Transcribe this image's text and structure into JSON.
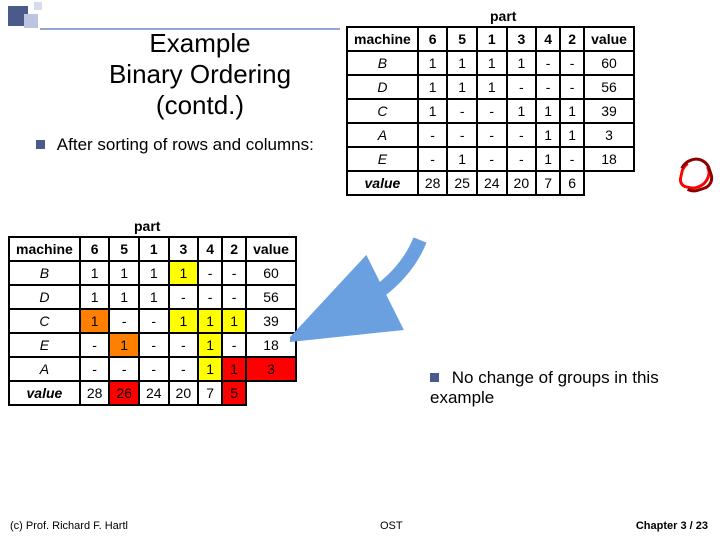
{
  "title": "Example\nBinary Ordering\n(contd.)",
  "bullet_after": "After sorting of rows and columns:",
  "bullet_nochange": "No change of groups in this example",
  "part_label": "part",
  "table_top": {
    "col_header": "machine",
    "parts": [
      "6",
      "5",
      "1",
      "3",
      "4",
      "2"
    ],
    "value_header": "value",
    "rows": [
      {
        "m": "B",
        "cells": [
          "1",
          "1",
          "1",
          "1",
          "-",
          "-"
        ],
        "val": "60"
      },
      {
        "m": "D",
        "cells": [
          "1",
          "1",
          "1",
          "-",
          "-",
          "-"
        ],
        "val": "56"
      },
      {
        "m": "C",
        "cells": [
          "1",
          "-",
          "-",
          "1",
          "1",
          "1"
        ],
        "val": "39"
      },
      {
        "m": "A",
        "cells": [
          "-",
          "-",
          "-",
          "-",
          "1",
          "1"
        ],
        "val": "3"
      },
      {
        "m": "E",
        "cells": [
          "-",
          "1",
          "-",
          "-",
          "1",
          "-"
        ],
        "val": "18"
      }
    ],
    "value_row_label": "value",
    "value_row": [
      "28",
      "25",
      "24",
      "20",
      "7",
      "6"
    ]
  },
  "table_mid": {
    "col_header": "machine",
    "parts": [
      "6",
      "5",
      "1",
      "3",
      "4",
      "2"
    ],
    "value_header": "value",
    "rows": [
      {
        "m": "B",
        "cells": [
          "1",
          "1",
          "1",
          "1",
          "-",
          "-"
        ],
        "val": "60",
        "hi": [
          0,
          0,
          0,
          "y",
          null,
          null
        ]
      },
      {
        "m": "D",
        "cells": [
          "1",
          "1",
          "1",
          "-",
          "-",
          "-"
        ],
        "val": "56",
        "hi": [
          0,
          0,
          0,
          null,
          null,
          null
        ]
      },
      {
        "m": "C",
        "cells": [
          "1",
          "-",
          "-",
          "1",
          "1",
          "1"
        ],
        "val": "39",
        "hi": [
          "o",
          null,
          null,
          "y",
          "y",
          "y"
        ]
      },
      {
        "m": "E",
        "cells": [
          "-",
          "1",
          "-",
          "-",
          "1",
          "-"
        ],
        "val": "18",
        "hi": [
          null,
          "o",
          null,
          null,
          "y",
          null
        ]
      },
      {
        "m": "A",
        "cells": [
          "-",
          "-",
          "-",
          "-",
          "1",
          "1"
        ],
        "val": "3",
        "hi": [
          null,
          null,
          null,
          null,
          "y",
          "r"
        ]
      }
    ],
    "value_row_label": "value",
    "value_row": [
      "28",
      "26",
      "24",
      "20",
      "7",
      "5"
    ],
    "value_row_hi": [
      null,
      "r",
      null,
      null,
      null,
      "r"
    ]
  },
  "footer": {
    "left": "(c) Prof. Richard F. Hartl",
    "mid": "OST",
    "right": "Chapter 3 / 23"
  },
  "chart_data": [
    {
      "type": "table",
      "title": "Machine-part incidence (before row swap)",
      "row_labels": [
        "B",
        "D",
        "C",
        "A",
        "E"
      ],
      "col_labels": [
        "6",
        "5",
        "1",
        "3",
        "4",
        "2"
      ],
      "matrix": [
        [
          1,
          1,
          1,
          1,
          0,
          0
        ],
        [
          1,
          1,
          1,
          0,
          0,
          0
        ],
        [
          1,
          0,
          0,
          1,
          1,
          1
        ],
        [
          0,
          0,
          0,
          0,
          1,
          1
        ],
        [
          0,
          1,
          0,
          0,
          1,
          0
        ]
      ],
      "row_values": [
        60,
        56,
        39,
        3,
        18
      ],
      "col_values": [
        28,
        25,
        24,
        20,
        7,
        6
      ]
    },
    {
      "type": "table",
      "title": "Machine-part incidence (after sorting)",
      "row_labels": [
        "B",
        "D",
        "C",
        "E",
        "A"
      ],
      "col_labels": [
        "6",
        "5",
        "1",
        "3",
        "4",
        "2"
      ],
      "matrix": [
        [
          1,
          1,
          1,
          1,
          0,
          0
        ],
        [
          1,
          1,
          1,
          0,
          0,
          0
        ],
        [
          1,
          0,
          0,
          1,
          1,
          1
        ],
        [
          0,
          1,
          0,
          0,
          1,
          0
        ],
        [
          0,
          0,
          0,
          0,
          1,
          1
        ]
      ],
      "row_values": [
        60,
        56,
        39,
        18,
        3
      ],
      "col_values": [
        28,
        26,
        24,
        20,
        7,
        5
      ]
    }
  ]
}
